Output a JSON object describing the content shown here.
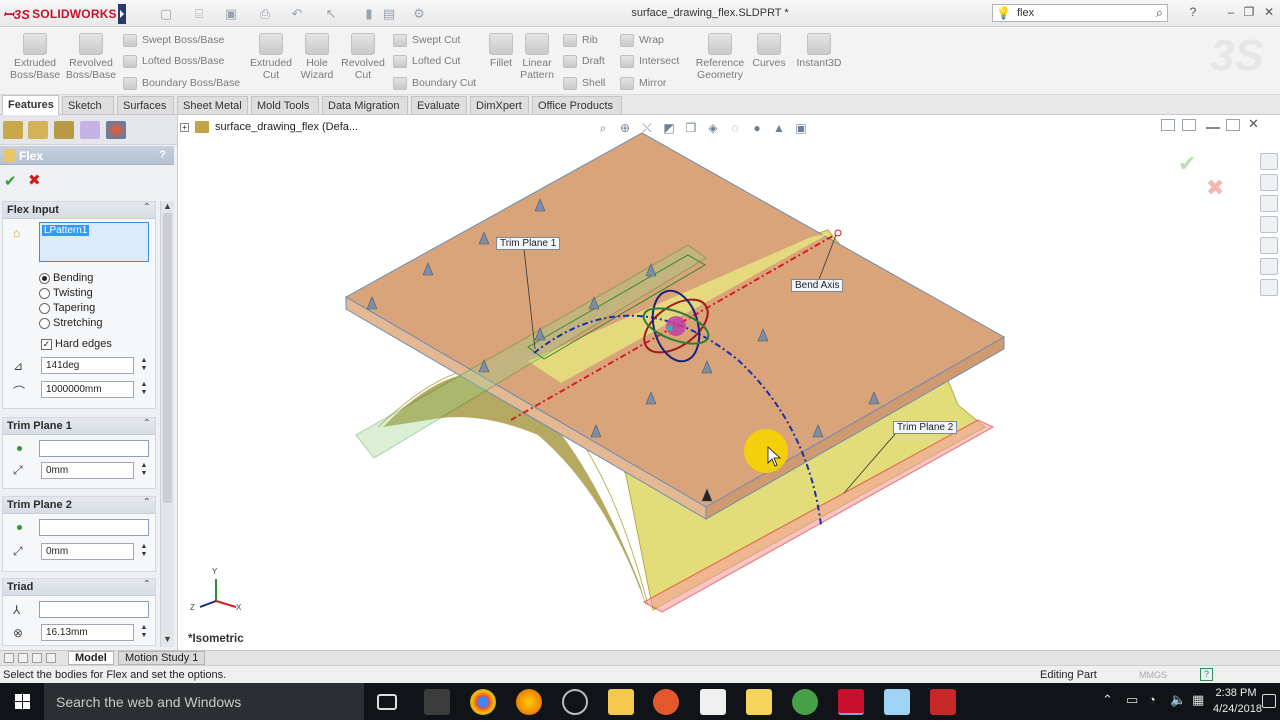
{
  "app": {
    "logo": "SOLIDWORKS",
    "doc_title": "surface_drawing_flex.SLDPRT *",
    "search_value": "flex"
  },
  "ribbon": {
    "big": [
      {
        "name": "extruded-boss-base",
        "label_1": "Extruded",
        "label_2": "Boss/Base"
      },
      {
        "name": "revolved-boss-base",
        "label_1": "Revolved",
        "label_2": "Boss/Base"
      },
      {
        "name": "extruded-cut",
        "label_1": "Extruded",
        "label_2": "Cut"
      },
      {
        "name": "hole-wizard",
        "label_1": "Hole",
        "label_2": "Wizard"
      },
      {
        "name": "revolved-cut",
        "label_1": "Revolved",
        "label_2": "Cut"
      },
      {
        "name": "fillet",
        "label_1": "Fillet",
        "label_2": ""
      },
      {
        "name": "linear-pattern",
        "label_1": "Linear",
        "label_2": "Pattern"
      },
      {
        "name": "reference-geometry",
        "label_1": "Reference",
        "label_2": "Geometry"
      },
      {
        "name": "curves",
        "label_1": "Curves",
        "label_2": ""
      },
      {
        "name": "instant3d",
        "label_1": "Instant3D",
        "label_2": ""
      }
    ],
    "small": {
      "swept_boss": "Swept Boss/Base",
      "lofted_boss": "Lofted Boss/Base",
      "boundary_boss": "Boundary Boss/Base",
      "swept_cut": "Swept Cut",
      "lofted_cut": "Lofted Cut",
      "boundary_cut": "Boundary Cut",
      "rib": "Rib",
      "draft": "Draft",
      "shell": "Shell",
      "wrap": "Wrap",
      "intersect": "Intersect",
      "mirror": "Mirror"
    }
  },
  "tabs": [
    "Features",
    "Sketch",
    "Surfaces",
    "Sheet Metal",
    "Mold Tools",
    "Data Migration",
    "Evaluate",
    "DimXpert",
    "Office Products"
  ],
  "pm": {
    "title": "Flex",
    "help": "?",
    "flex_input": {
      "header": "Flex Input",
      "selection": "LPattern1",
      "modes": [
        "Bending",
        "Twisting",
        "Tapering",
        "Stretching"
      ],
      "selected_mode": "Bending",
      "hard_edges_label": "Hard edges",
      "hard_edges_checked": true,
      "angle": "141deg",
      "radius": "1000000mm"
    },
    "trim1": {
      "header": "Trim Plane 1",
      "value": "0mm"
    },
    "trim2": {
      "header": "Trim Plane 2",
      "value": "0mm"
    },
    "triad": {
      "header": "Triad",
      "value": "16.13mm"
    }
  },
  "viewport": {
    "tree_item": "surface_drawing_flex  (Defa...",
    "view_name": "*Isometric",
    "callouts": {
      "trim_plane_1": "Trim Plane 1",
      "bend_axis": "Bend Axis",
      "trim_plane_2": "Trim Plane 2"
    },
    "triad_labels": {
      "y": "Y",
      "x": "X",
      "z": "Z"
    }
  },
  "bottom_tabs": [
    "Model",
    "Motion Study 1"
  ],
  "status": {
    "message": "Select the bodies for Flex and set the options.",
    "mode": "Editing Part",
    "units": "MMGS"
  },
  "taskbar": {
    "search_placeholder": "Search the web and Windows",
    "time": "2:38 PM",
    "date": "4/24/2018"
  },
  "colors": {
    "plate": "#d9a47a",
    "surface": "#e3dc7a",
    "trim1": "#2e8b2e",
    "trim2": "#e02a2a",
    "bend_axis": "#d81e1e"
  }
}
